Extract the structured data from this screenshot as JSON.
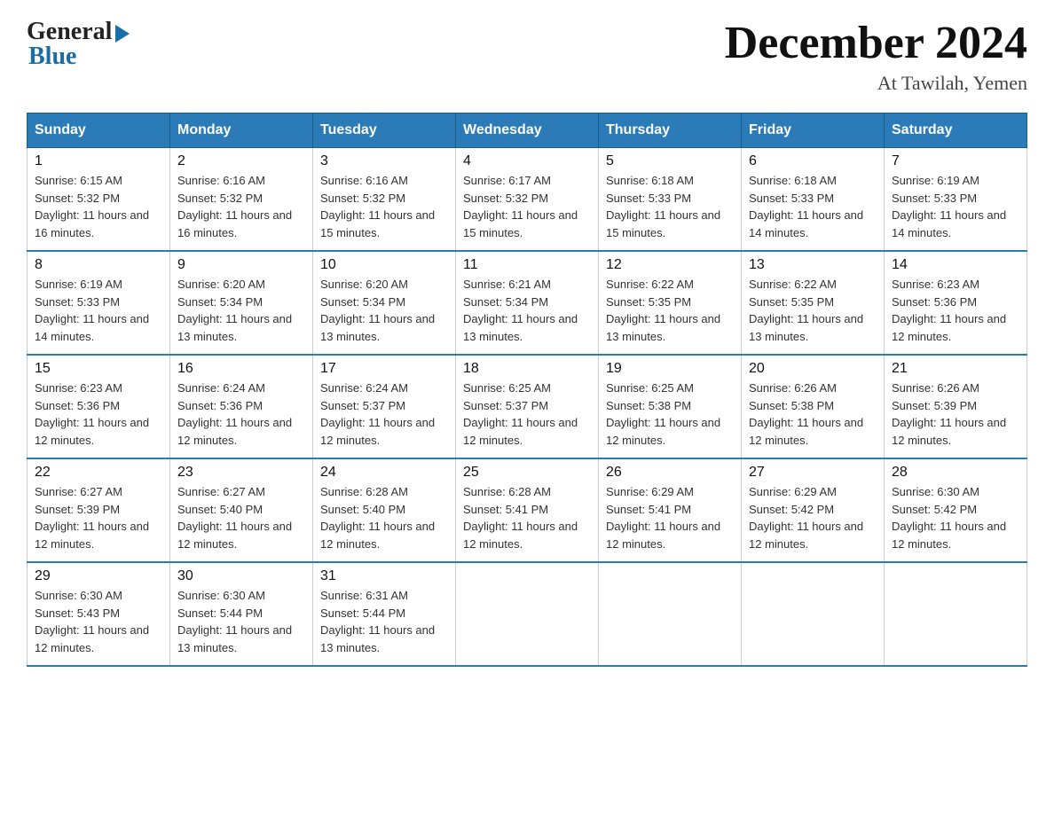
{
  "logo": {
    "general": "General",
    "blue": "Blue"
  },
  "title": "December 2024",
  "location": "At Tawilah, Yemen",
  "headers": [
    "Sunday",
    "Monday",
    "Tuesday",
    "Wednesday",
    "Thursday",
    "Friday",
    "Saturday"
  ],
  "weeks": [
    [
      {
        "day": "1",
        "sunrise": "6:15 AM",
        "sunset": "5:32 PM",
        "daylight": "11 hours and 16 minutes."
      },
      {
        "day": "2",
        "sunrise": "6:16 AM",
        "sunset": "5:32 PM",
        "daylight": "11 hours and 16 minutes."
      },
      {
        "day": "3",
        "sunrise": "6:16 AM",
        "sunset": "5:32 PM",
        "daylight": "11 hours and 15 minutes."
      },
      {
        "day": "4",
        "sunrise": "6:17 AM",
        "sunset": "5:32 PM",
        "daylight": "11 hours and 15 minutes."
      },
      {
        "day": "5",
        "sunrise": "6:18 AM",
        "sunset": "5:33 PM",
        "daylight": "11 hours and 15 minutes."
      },
      {
        "day": "6",
        "sunrise": "6:18 AM",
        "sunset": "5:33 PM",
        "daylight": "11 hours and 14 minutes."
      },
      {
        "day": "7",
        "sunrise": "6:19 AM",
        "sunset": "5:33 PM",
        "daylight": "11 hours and 14 minutes."
      }
    ],
    [
      {
        "day": "8",
        "sunrise": "6:19 AM",
        "sunset": "5:33 PM",
        "daylight": "11 hours and 14 minutes."
      },
      {
        "day": "9",
        "sunrise": "6:20 AM",
        "sunset": "5:34 PM",
        "daylight": "11 hours and 13 minutes."
      },
      {
        "day": "10",
        "sunrise": "6:20 AM",
        "sunset": "5:34 PM",
        "daylight": "11 hours and 13 minutes."
      },
      {
        "day": "11",
        "sunrise": "6:21 AM",
        "sunset": "5:34 PM",
        "daylight": "11 hours and 13 minutes."
      },
      {
        "day": "12",
        "sunrise": "6:22 AM",
        "sunset": "5:35 PM",
        "daylight": "11 hours and 13 minutes."
      },
      {
        "day": "13",
        "sunrise": "6:22 AM",
        "sunset": "5:35 PM",
        "daylight": "11 hours and 13 minutes."
      },
      {
        "day": "14",
        "sunrise": "6:23 AM",
        "sunset": "5:36 PM",
        "daylight": "11 hours and 12 minutes."
      }
    ],
    [
      {
        "day": "15",
        "sunrise": "6:23 AM",
        "sunset": "5:36 PM",
        "daylight": "11 hours and 12 minutes."
      },
      {
        "day": "16",
        "sunrise": "6:24 AM",
        "sunset": "5:36 PM",
        "daylight": "11 hours and 12 minutes."
      },
      {
        "day": "17",
        "sunrise": "6:24 AM",
        "sunset": "5:37 PM",
        "daylight": "11 hours and 12 minutes."
      },
      {
        "day": "18",
        "sunrise": "6:25 AM",
        "sunset": "5:37 PM",
        "daylight": "11 hours and 12 minutes."
      },
      {
        "day": "19",
        "sunrise": "6:25 AM",
        "sunset": "5:38 PM",
        "daylight": "11 hours and 12 minutes."
      },
      {
        "day": "20",
        "sunrise": "6:26 AM",
        "sunset": "5:38 PM",
        "daylight": "11 hours and 12 minutes."
      },
      {
        "day": "21",
        "sunrise": "6:26 AM",
        "sunset": "5:39 PM",
        "daylight": "11 hours and 12 minutes."
      }
    ],
    [
      {
        "day": "22",
        "sunrise": "6:27 AM",
        "sunset": "5:39 PM",
        "daylight": "11 hours and 12 minutes."
      },
      {
        "day": "23",
        "sunrise": "6:27 AM",
        "sunset": "5:40 PM",
        "daylight": "11 hours and 12 minutes."
      },
      {
        "day": "24",
        "sunrise": "6:28 AM",
        "sunset": "5:40 PM",
        "daylight": "11 hours and 12 minutes."
      },
      {
        "day": "25",
        "sunrise": "6:28 AM",
        "sunset": "5:41 PM",
        "daylight": "11 hours and 12 minutes."
      },
      {
        "day": "26",
        "sunrise": "6:29 AM",
        "sunset": "5:41 PM",
        "daylight": "11 hours and 12 minutes."
      },
      {
        "day": "27",
        "sunrise": "6:29 AM",
        "sunset": "5:42 PM",
        "daylight": "11 hours and 12 minutes."
      },
      {
        "day": "28",
        "sunrise": "6:30 AM",
        "sunset": "5:42 PM",
        "daylight": "11 hours and 12 minutes."
      }
    ],
    [
      {
        "day": "29",
        "sunrise": "6:30 AM",
        "sunset": "5:43 PM",
        "daylight": "11 hours and 12 minutes."
      },
      {
        "day": "30",
        "sunrise": "6:30 AM",
        "sunset": "5:44 PM",
        "daylight": "11 hours and 13 minutes."
      },
      {
        "day": "31",
        "sunrise": "6:31 AM",
        "sunset": "5:44 PM",
        "daylight": "11 hours and 13 minutes."
      },
      null,
      null,
      null,
      null
    ]
  ]
}
